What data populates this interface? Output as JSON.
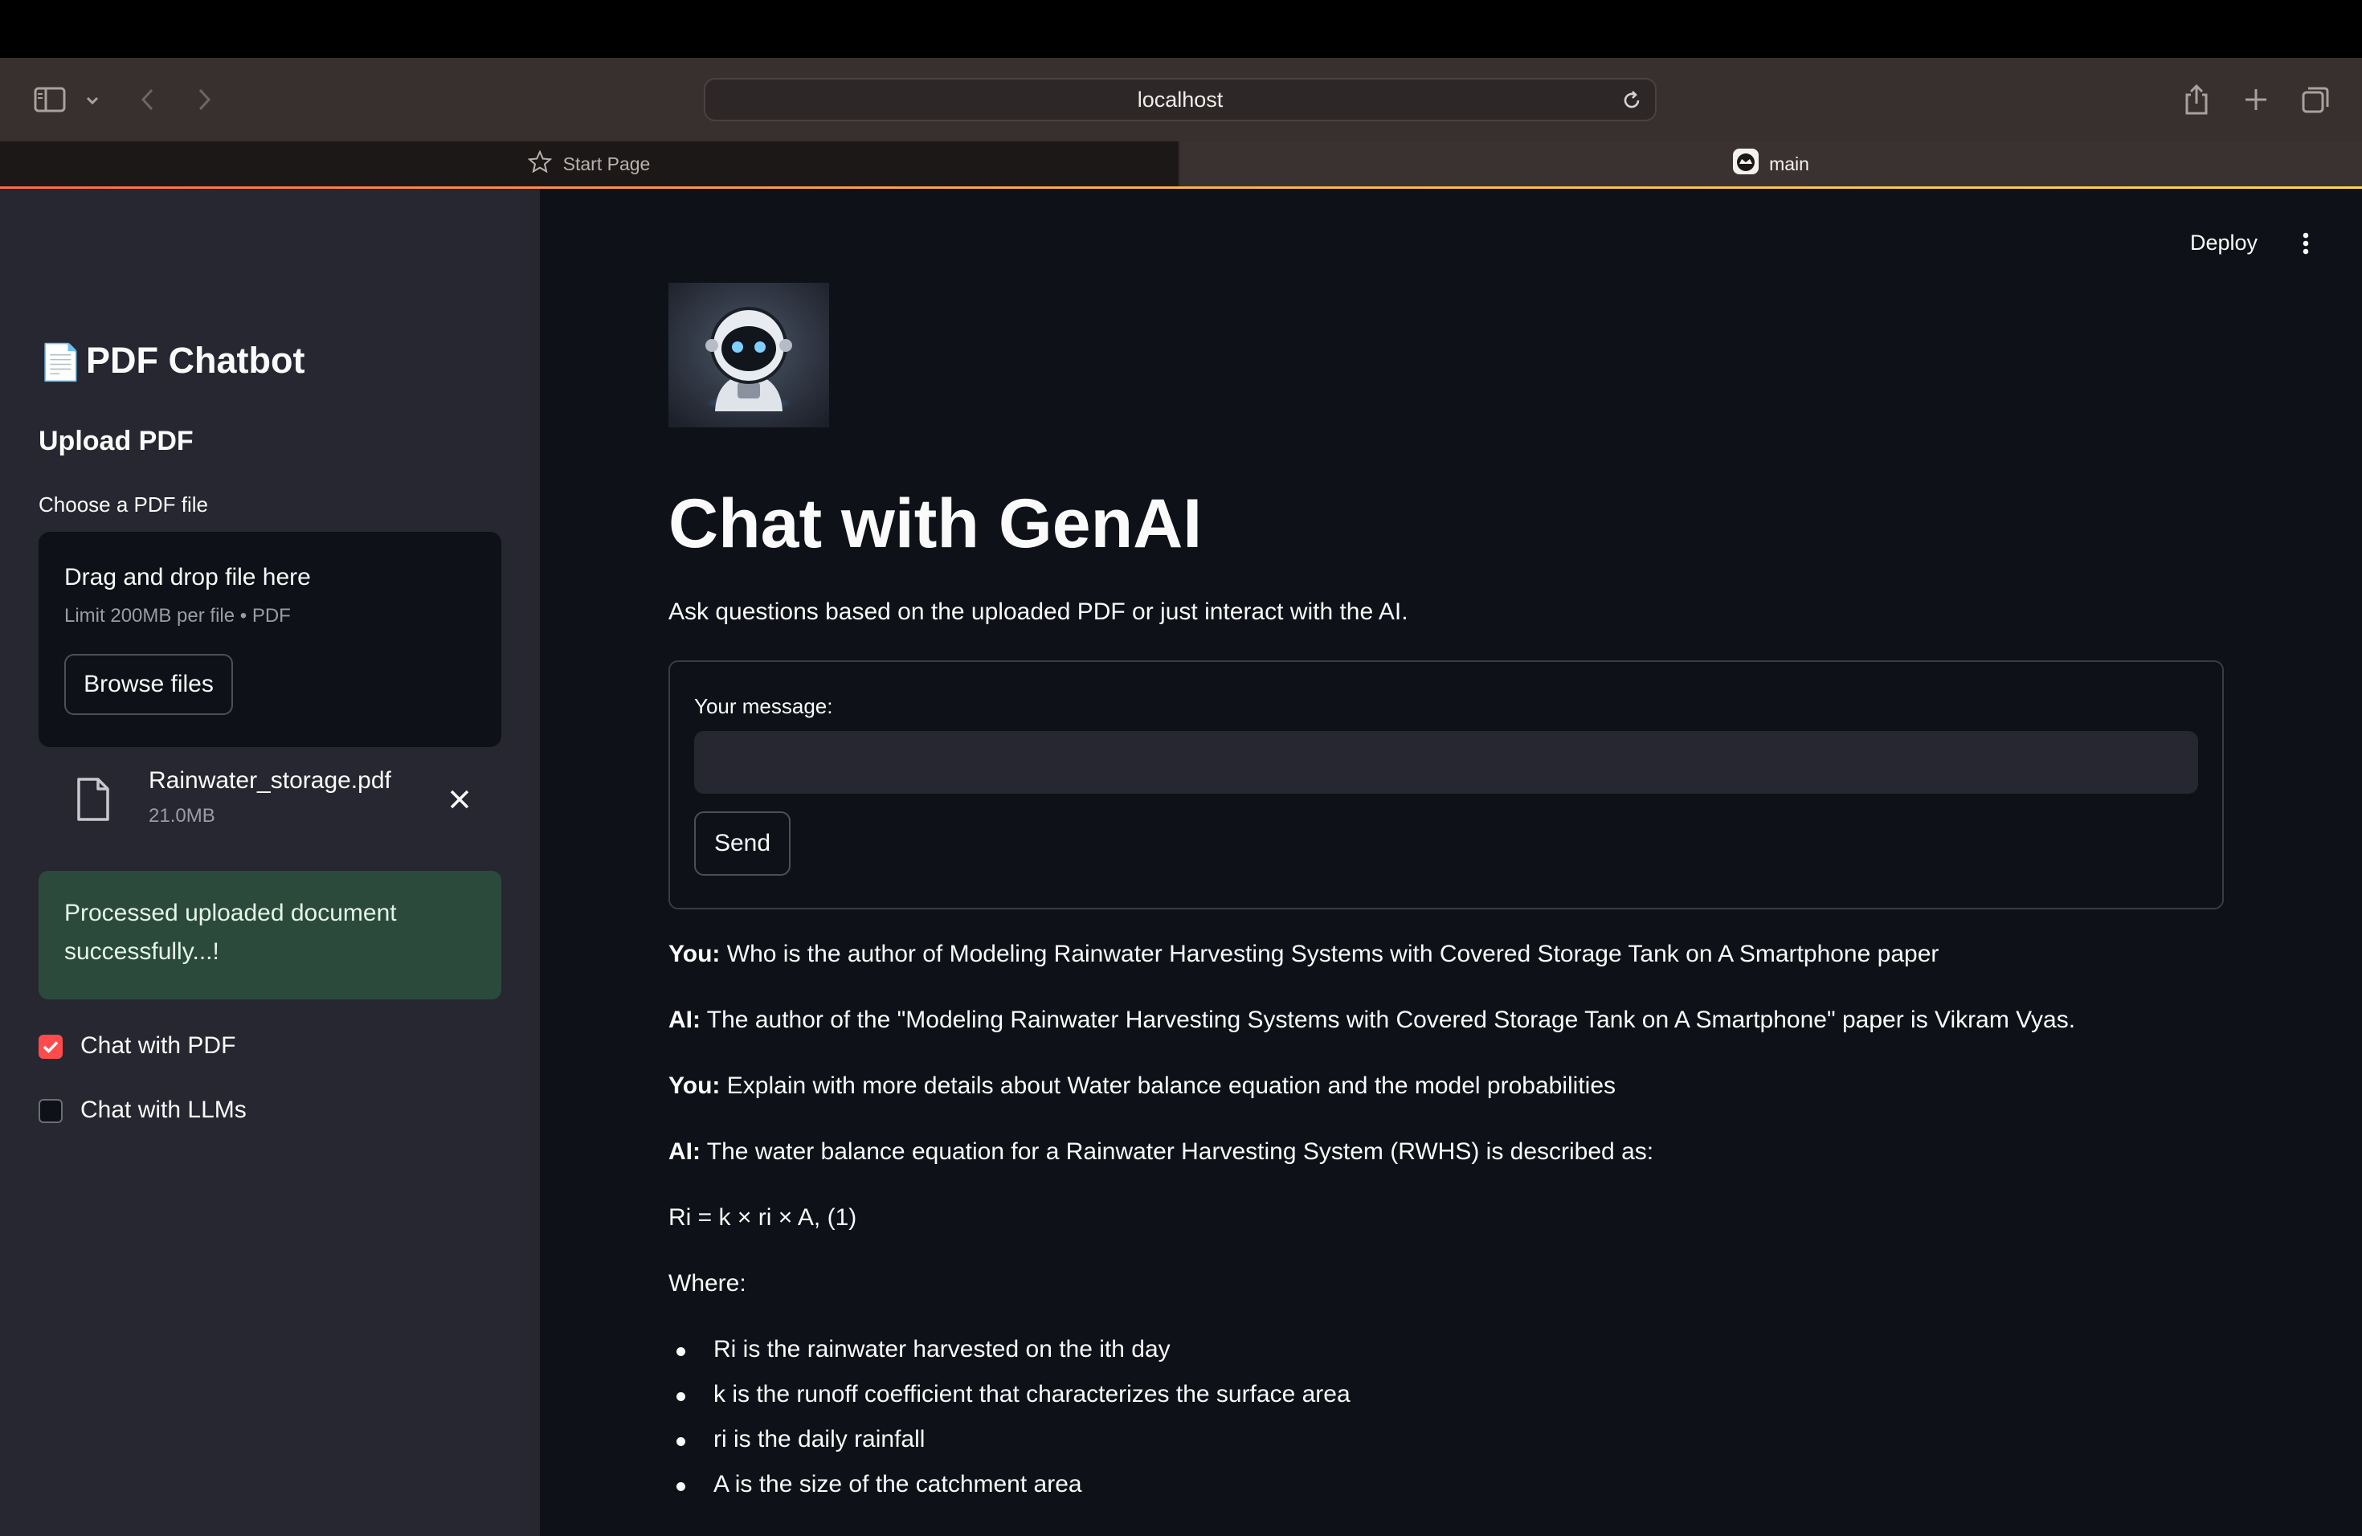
{
  "browser": {
    "url": "localhost",
    "tabs": [
      {
        "label": "Start Page"
      },
      {
        "label": "main"
      }
    ]
  },
  "header": {
    "deploy_label": "Deploy"
  },
  "sidebar": {
    "title_icon": "📄",
    "title": "PDF Chatbot",
    "section_heading": "Upload PDF",
    "uploader_label": "Choose a PDF file",
    "dropzone_title": "Drag and drop file here",
    "dropzone_limit": "Limit 200MB per file • PDF",
    "browse_label": "Browse files",
    "uploaded_file": {
      "name": "Rainwater_storage.pdf",
      "size": "21.0MB"
    },
    "success_line1": "Processed uploaded document",
    "success_line2": "successfully...!",
    "options": [
      {
        "label": "Chat with PDF",
        "checked": true
      },
      {
        "label": "Chat with LLMs",
        "checked": false
      }
    ]
  },
  "main": {
    "title": "Chat with GenAI",
    "subtitle": "Ask questions based on the uploaded PDF or just interact with the AI.",
    "form": {
      "input_label": "Your message:",
      "input_value": "",
      "send_label": "Send"
    },
    "chat": [
      {
        "speaker": "You:",
        "text": "Who is the author of Modeling Rainwater Harvesting Systems with Covered Storage Tank on A Smartphone paper"
      },
      {
        "speaker": "AI:",
        "text": "The author of the \"Modeling Rainwater Harvesting Systems with Covered Storage Tank on A Smartphone\" paper is Vikram Vyas."
      },
      {
        "speaker": "You:",
        "text": "Explain with more details about Water balance equation and the model probabilities"
      },
      {
        "speaker": "AI:",
        "text": "The water balance equation for a Rainwater Harvesting System (RWHS) is described as:"
      }
    ],
    "equation": "Ri = k × ri × A, (1)",
    "where_label": "Where:",
    "bullets": [
      "Ri is the rainwater harvested on the ith day",
      "k is the runoff coefficient that characterizes the surface area",
      "ri is the daily rainfall",
      "A is the size of the catchment area"
    ]
  },
  "colors": {
    "accent": "#ff4b4b",
    "success_bg": "#2c4a3c",
    "sidebar_bg": "#262730",
    "main_bg": "#0e1117"
  }
}
